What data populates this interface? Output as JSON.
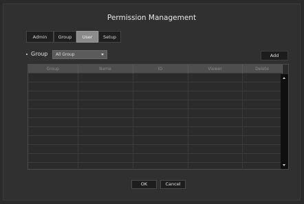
{
  "title": "Permission Management",
  "tabs": [
    {
      "label": "Admin"
    },
    {
      "label": "Group"
    },
    {
      "label": "User",
      "active": true
    },
    {
      "label": "Setup"
    }
  ],
  "filter": {
    "label": "Group",
    "selected": "All Group"
  },
  "add_label": "Add",
  "table": {
    "headers": [
      "Group",
      "Name",
      "ID",
      "Viewer",
      "Delete"
    ],
    "rows": [
      [
        "",
        "",
        "",
        "",
        ""
      ],
      [
        "",
        "",
        "",
        "",
        ""
      ],
      [
        "",
        "",
        "",
        "",
        ""
      ],
      [
        "",
        "",
        "",
        "",
        ""
      ],
      [
        "",
        "",
        "",
        "",
        ""
      ],
      [
        "",
        "",
        "",
        "",
        ""
      ],
      [
        "",
        "",
        "",
        "",
        ""
      ],
      [
        "",
        "",
        "",
        "",
        ""
      ],
      [
        "",
        "",
        "",
        "",
        ""
      ],
      [
        "",
        "",
        "",
        "",
        ""
      ],
      [
        "",
        "",
        "",
        "",
        ""
      ]
    ]
  },
  "footer": {
    "ok_label": "OK",
    "cancel_label": "Cancel"
  },
  "icons": {
    "dropdown": "chevron-down-icon",
    "scroll_up": "scroll-up-icon",
    "scroll_down": "scroll-down-icon"
  }
}
